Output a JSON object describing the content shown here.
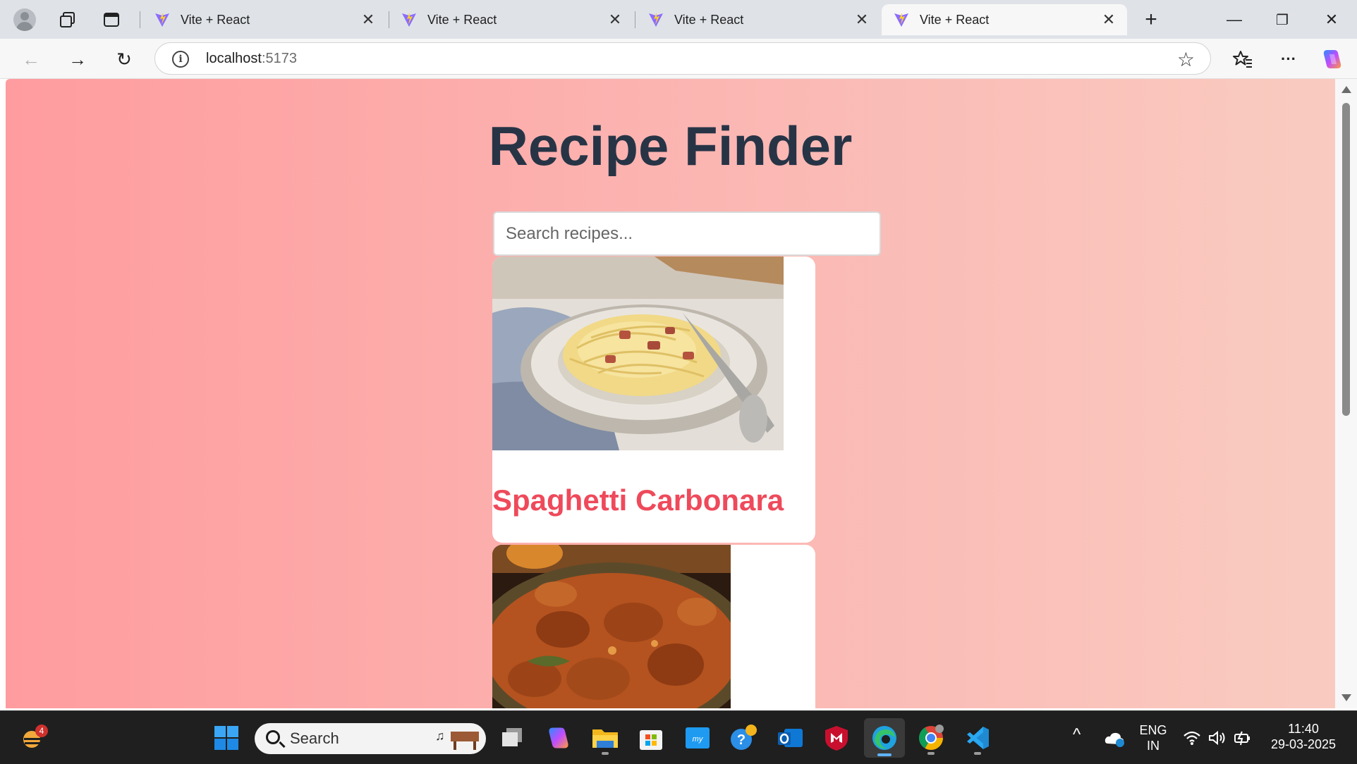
{
  "browser": {
    "tabs": [
      {
        "title": "Vite + React",
        "active": false
      },
      {
        "title": "Vite + React",
        "active": false
      },
      {
        "title": "Vite + React",
        "active": false
      },
      {
        "title": "Vite + React",
        "active": true
      }
    ],
    "tab_close_glyph": "✕",
    "new_tab_glyph": "+",
    "window_controls": {
      "minimize": "—",
      "restore": "❐",
      "close": "✕"
    },
    "address": {
      "host": "localhost",
      "port": ":5173"
    },
    "icons": {
      "back": "back-arrow-icon",
      "forward": "forward-arrow-icon",
      "reload": "reload-icon",
      "info": "site-info-icon",
      "favorite": "star-icon",
      "favorites": "favorites-icon",
      "more": "more-icon",
      "copilot": "copilot-icon"
    },
    "glyphs": {
      "back": "←",
      "forward": "→",
      "reload": "↻",
      "info": "i",
      "star": "☆",
      "favorites": "✩",
      "more": "···"
    }
  },
  "page": {
    "title": "Recipe Finder",
    "search_placeholder": "Search recipes...",
    "recipes": [
      {
        "name": "Spaghetti Carbonara",
        "image": "spaghetti-carbonara-photo"
      },
      {
        "name": "",
        "image": "chicken-curry-photo"
      }
    ]
  },
  "taskbar": {
    "search_label": "Search",
    "widgets_badge": "4",
    "language": {
      "line1": "ENG",
      "line2": "IN"
    },
    "clock": {
      "time": "11:40",
      "date": "29-03-2025"
    },
    "tray_chevron": "^",
    "apps": [
      "start",
      "search",
      "task-view",
      "copilot",
      "file-explorer",
      "microsoft-store",
      "myhp",
      "get-help",
      "outlook",
      "mcafee",
      "edge",
      "chrome",
      "vscode"
    ]
  },
  "colors": {
    "page_gradient_start": "#ff9c9f",
    "page_gradient_end": "#f9cbc0",
    "title": "#273446",
    "recipe_name": "#ee4a5b"
  }
}
